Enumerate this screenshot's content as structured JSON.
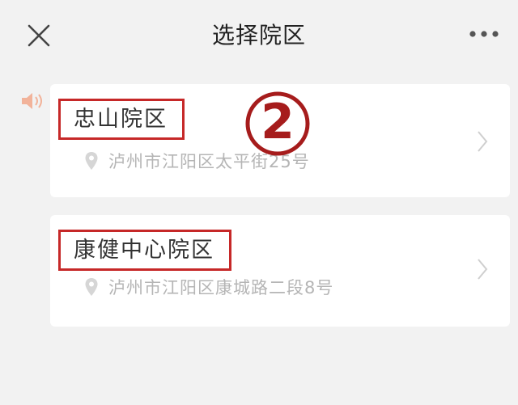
{
  "nav": {
    "title": "选择院区",
    "close_icon": "close-icon",
    "more_icon": "more-horizontal-icon"
  },
  "speaker_icon": "speaker-icon",
  "step_marker": {
    "number": "2",
    "color": "#a61c1c"
  },
  "campuses": [
    {
      "name": "忠山院区",
      "address": "泸州市江阳区太平街25号"
    },
    {
      "name": "康健中心院区",
      "address": "泸州市江阳区康城路二段8号"
    }
  ],
  "colors": {
    "highlight_border": "#c62828",
    "background": "#f2f2f2",
    "address_text": "#b5b5b5"
  }
}
